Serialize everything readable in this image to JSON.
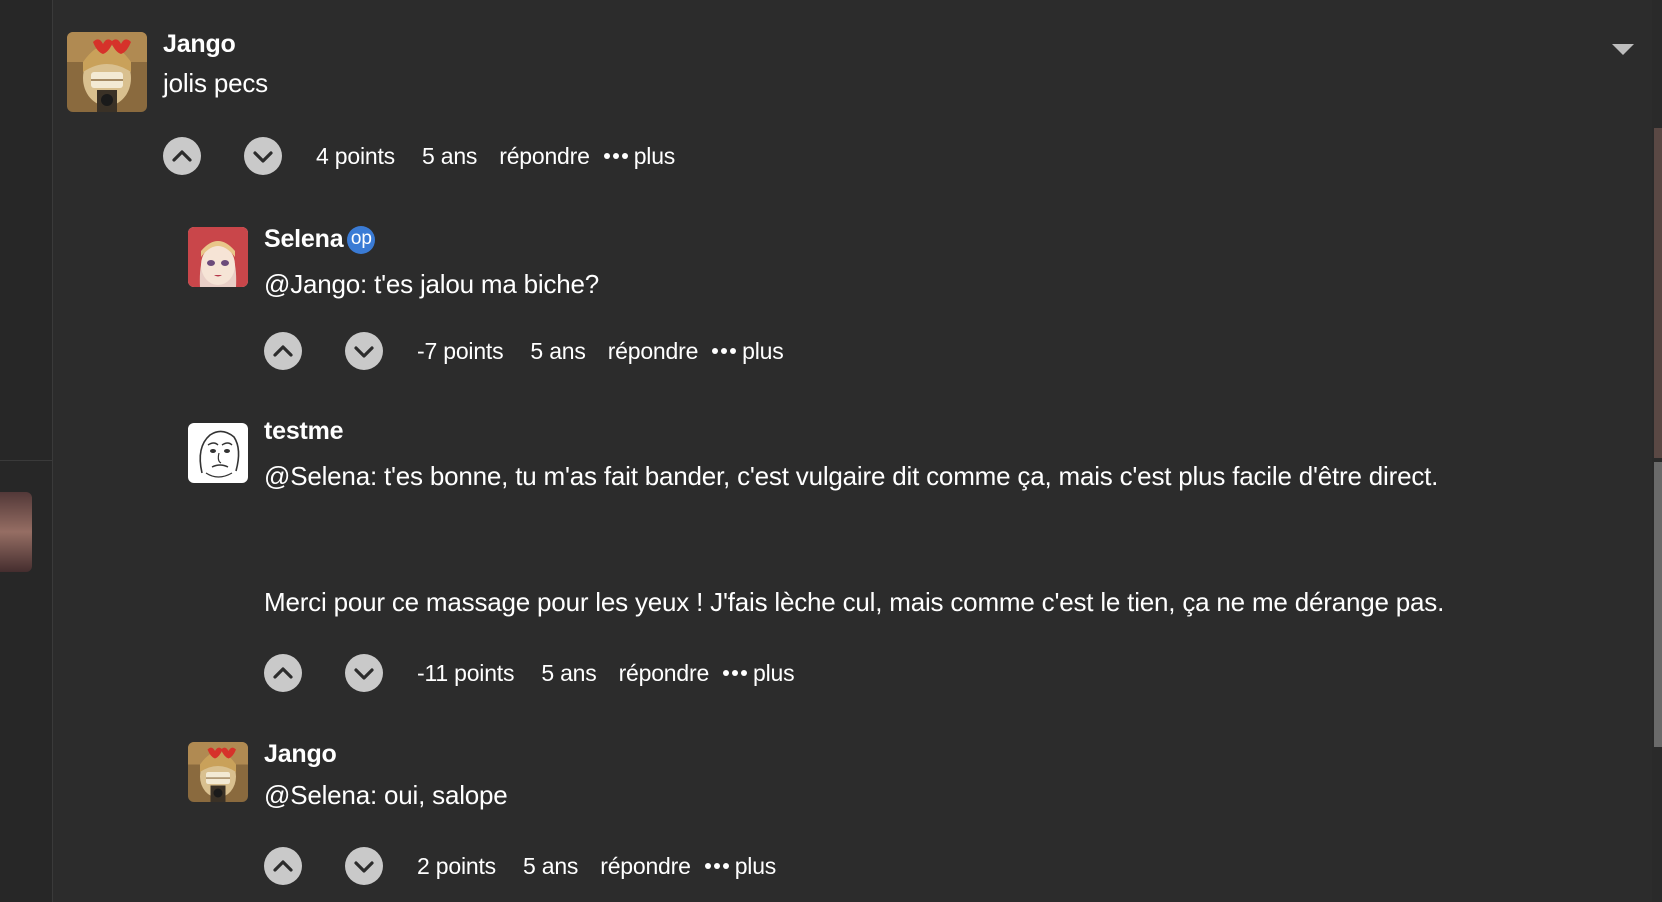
{
  "comments": [
    {
      "author": "Jango",
      "text": "jolis pecs",
      "points": "4 points",
      "age": "5 ans",
      "reply": "répondre",
      "more": "plus",
      "avatar": "jango-avatar"
    },
    {
      "author": "Selena",
      "badge": "op",
      "text": "@Jango: t'es jalou ma biche?",
      "points": "-7 points",
      "age": "5 ans",
      "reply": "répondre",
      "more": "plus",
      "avatar": "selena-avatar"
    },
    {
      "author": "testme",
      "text_lines": [
        "@Selena: t'es bonne, tu m'as fait bander, c'est vulgaire dit comme ça, mais c'est plus facile d'être direct.",
        "Merci pour ce massage pour les yeux ! J'fais lèche cul, mais comme c'est le tien, ça ne me dérange pas."
      ],
      "points": "-11 points",
      "age": "5 ans",
      "reply": "répondre",
      "more": "plus",
      "avatar": "meme-face-avatar"
    },
    {
      "author": "Jango",
      "text": "@Selena: oui, salope",
      "points": "2 points",
      "age": "5 ans",
      "reply": "répondre",
      "more": "plus",
      "avatar": "jango-avatar"
    }
  ],
  "icons": {
    "upvote": "chevron-up-icon",
    "downvote": "chevron-down-icon",
    "collapse": "caret-down-icon",
    "more": "ellipsis-icon"
  },
  "colors": {
    "background": "#2c2c2c",
    "vote_button": "#c9c9c9",
    "op_badge": "#3a7bd5"
  }
}
